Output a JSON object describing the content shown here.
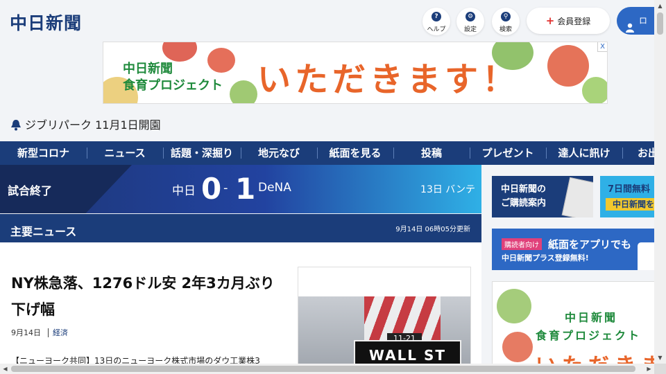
{
  "header": {
    "logo": "中日新聞",
    "help_label": "ヘルプ",
    "settings_label": "設定",
    "search_label": "検索",
    "member_label": "会員登録",
    "login_label": "ロ"
  },
  "banner": {
    "line1": "中日新聞",
    "line2": "食育プロジェクト",
    "headline": "いただきます！",
    "close": "X"
  },
  "ticker": {
    "text": "ジブリパーク 11月1日開園"
  },
  "nav": {
    "items": [
      "新型コロナ",
      "ニュース",
      "話題・深掘り",
      "地元なび",
      "紙面を見る",
      "投稿",
      "プレゼント",
      "達人に訊け",
      "お出"
    ]
  },
  "score": {
    "status": "試合終了",
    "home_team": "中日",
    "home_score": "0",
    "separator": "-",
    "away_score": "1",
    "away_team": "DeNA",
    "venue": "13日 バンテ"
  },
  "main_news": {
    "title": "主要ニュース",
    "updated": "9月14日 06時05分更新"
  },
  "article": {
    "title": "NY株急落、1276ドル安 2年3カ月ぶり下げ幅",
    "date": "9月14日",
    "category": "経済",
    "excerpt": "【ニューヨーク共同】13日のニューヨーク株式市場のダウ工業株3",
    "photo_sign": "WALL ST",
    "photo_num": "11-21"
  },
  "sidebar": {
    "subscribe_line1": "中日新聞の",
    "subscribe_line2": "ご購読案内",
    "trial_line1": "7日間無料",
    "trial_line2": "中日新聞を",
    "app_badge": "購読者向け",
    "app_title": "紙面をアプリでも",
    "app_sub": "中日新聞プラス登録無料!",
    "food_line1": "中日新聞",
    "food_line2": "食育プロジェクト",
    "food_line3": "いただきま"
  },
  "colors": {
    "brand_navy": "#1b3d7a",
    "brand_blue": "#2d68c4",
    "accent_orange": "#e8652a",
    "accent_green": "#1f8a3c"
  }
}
